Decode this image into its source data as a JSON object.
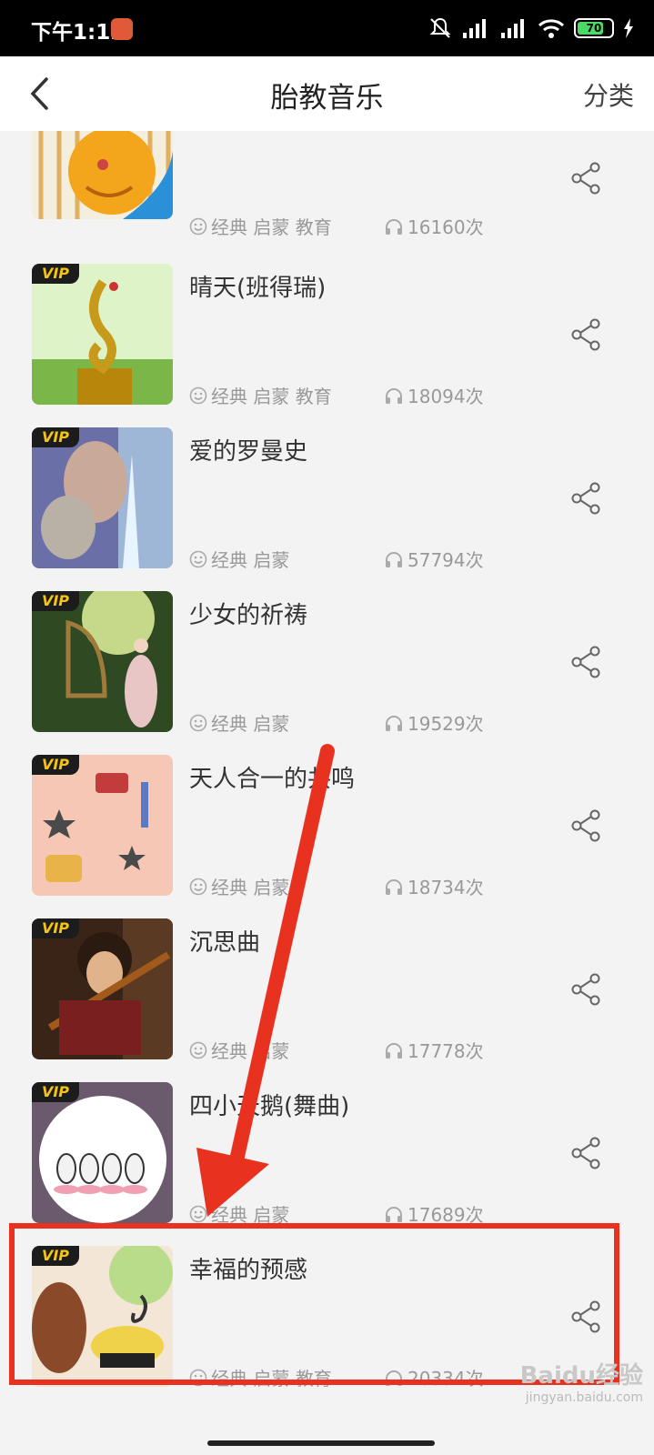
{
  "status_bar": {
    "time": "下午1:12",
    "battery": "70"
  },
  "nav": {
    "title": "胎教音乐",
    "category": "分类"
  },
  "songs": [
    {
      "title": "",
      "tags": "经典 启蒙 教育",
      "plays": "16160次",
      "vip": ""
    },
    {
      "title": "晴天(班得瑞)",
      "tags": "经典 启蒙 教育",
      "plays": "18094次",
      "vip": "VIP"
    },
    {
      "title": "爱的罗曼史",
      "tags": "经典 启蒙",
      "plays": "57794次",
      "vip": "VIP"
    },
    {
      "title": "少女的祈祷",
      "tags": "经典 启蒙",
      "plays": "19529次",
      "vip": "VIP"
    },
    {
      "title": "天人合一的共鸣",
      "tags": "经典 启蒙",
      "plays": "18734次",
      "vip": "VIP"
    },
    {
      "title": "沉思曲",
      "tags": "经典 启蒙",
      "plays": "17778次",
      "vip": "VIP"
    },
    {
      "title": "四小天鹅(舞曲)",
      "tags": "经典 启蒙",
      "plays": "17689次",
      "vip": "VIP"
    },
    {
      "title": "幸福的预感",
      "tags": "经典 启蒙 教育",
      "plays": "20334次",
      "vip": "VIP"
    }
  ],
  "watermark": {
    "brand": "Baidu经验",
    "url": "jingyan.baidu.com"
  },
  "colors": {
    "annotation_red": "#e8321f",
    "vip_gold": "#f5c218"
  }
}
